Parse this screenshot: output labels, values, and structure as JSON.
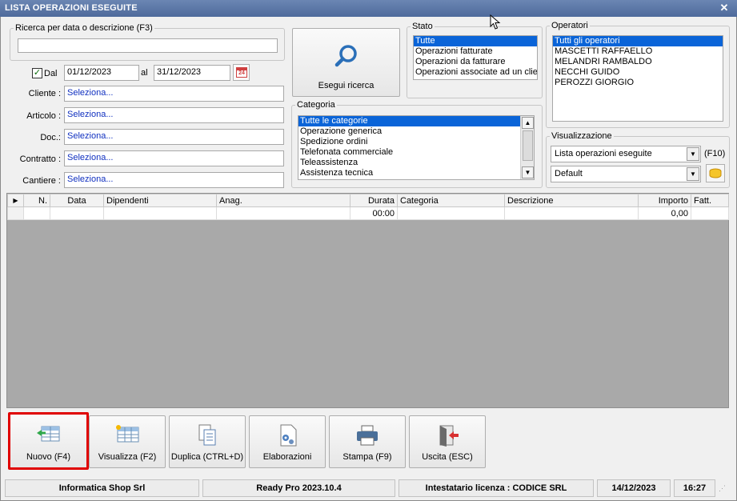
{
  "window": {
    "title": "LISTA OPERAZIONI ESEGUITE"
  },
  "search": {
    "group_label": "Ricerca per data o descrizione (F3)",
    "text_value": "",
    "dal_label": "Dal",
    "dal_checked": true,
    "date_from": "01/12/2023",
    "al_label": "al",
    "date_to": "31/12/2023",
    "calendar_label": "24"
  },
  "filters": [
    {
      "label": "Cliente :",
      "value": "Seleziona..."
    },
    {
      "label": "Articolo :",
      "value": "Seleziona..."
    },
    {
      "label": "Doc.:",
      "value": "Seleziona..."
    },
    {
      "label": "Contratto :",
      "value": "Seleziona..."
    },
    {
      "label": "Cantiere :",
      "value": "Seleziona..."
    }
  ],
  "execute_button": {
    "label": "Esegui ricerca",
    "icon": "magnifier-icon"
  },
  "stato": {
    "label": "Stato",
    "items": [
      "Tutte",
      "Operazioni fatturate",
      "Operazioni da fatturare",
      "Operazioni associate ad un clien"
    ],
    "selected": 0
  },
  "operatori": {
    "label": "Operatori",
    "items": [
      "Tutti gli operatori",
      "MASCETTI RAFFAELLO",
      "MELANDRI RAMBALDO",
      "NECCHI GUIDO",
      "PEROZZI GIORGIO"
    ],
    "selected": 0
  },
  "categoria": {
    "label": "Categoria",
    "items": [
      "Tutte le categorie",
      "Operazione generica",
      "Spedizione ordini",
      "Telefonata commerciale",
      "Teleassistenza",
      "Assistenza tecnica"
    ],
    "selected": 0
  },
  "visualizzazione": {
    "label": "Visualizzazione",
    "view_value": "Lista operazioni eseguite",
    "shortcut": "(F10)",
    "layout_value": "Default"
  },
  "grid": {
    "columns": [
      "N.",
      "Data",
      "Dipendenti",
      "Anag.",
      "Durata",
      "Categoria",
      "Descrizione",
      "Importo",
      "Fatt."
    ],
    "row": [
      "",
      "",
      "",
      "",
      "00:00",
      "",
      "",
      "0,00",
      ""
    ]
  },
  "toolbar": [
    {
      "label": "Nuovo (F4)",
      "icon": "new-icon"
    },
    {
      "label": "Visualizza (F2)",
      "icon": "view-icon"
    },
    {
      "label": "Duplica (CTRL+D)",
      "icon": "duplicate-icon"
    },
    {
      "label": "Elaborazioni",
      "icon": "process-icon"
    },
    {
      "label": "Stampa (F9)",
      "icon": "printer-icon"
    },
    {
      "label": "Uscita (ESC)",
      "icon": "exit-icon"
    }
  ],
  "status": {
    "company": "Informatica Shop Srl",
    "version": "Ready Pro 2023.10.4",
    "license": "Intestatario licenza : CODICE SRL",
    "date": "14/12/2023",
    "time": "16:27"
  },
  "colors": {
    "title_bar": "#5a76a8",
    "selection": "#0a64d8",
    "link_text": "#1030c0",
    "highlight_border": "#e00000"
  }
}
